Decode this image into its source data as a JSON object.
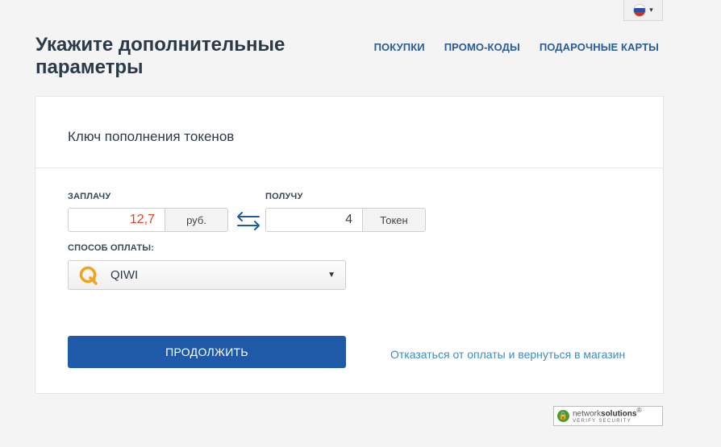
{
  "language": {
    "selected": "ru",
    "icon": "russia-flag-icon"
  },
  "page": {
    "title": "Укажите дополнительные параметры"
  },
  "nav": {
    "items": [
      {
        "label": "ПОКУПКИ"
      },
      {
        "label": "ПРОМО-КОДЫ"
      },
      {
        "label": "ПОДАРОЧНЫЕ КАРТЫ"
      }
    ]
  },
  "card": {
    "title": "Ключ пополнения токенов"
  },
  "pay": {
    "label": "ЗАПЛАЧУ",
    "value": "12,7",
    "unit": "руб.",
    "value_color": "#e0422b"
  },
  "receive": {
    "label": "ПОЛУЧУ",
    "value": "4",
    "unit": "Токен",
    "value_color": "#444444"
  },
  "payment_method": {
    "label": "СПОСОБ ОПЛАТЫ:",
    "selected": "QIWI",
    "icon": "qiwi-icon"
  },
  "actions": {
    "continue_label": "ПРОДОЛЖИТЬ",
    "cancel_label": "Отказаться от оплаты и вернуться в магазин"
  },
  "badge": {
    "brand_light": "network",
    "brand_bold": "solutions",
    "registered": "®",
    "sub": "VERIFY SECURITY"
  },
  "colors": {
    "accent": "#1e5aa8",
    "link": "#3a8dc6",
    "nav": "#2a5d9a"
  }
}
